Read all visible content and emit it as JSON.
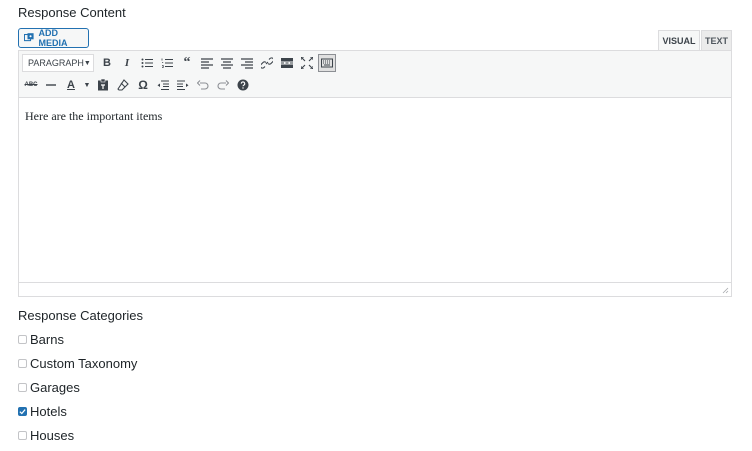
{
  "response_content": {
    "title": "Response Content",
    "add_media_label": "ADD MEDIA",
    "tabs": {
      "visual": "VISUAL",
      "text": "TEXT"
    },
    "format_select": "PARAGRAPH",
    "editor_text": "Here are the important items"
  },
  "response_categories": {
    "title": "Response Categories",
    "items": [
      {
        "label": "Barns",
        "checked": false
      },
      {
        "label": "Custom Taxonomy",
        "checked": false
      },
      {
        "label": "Garages",
        "checked": false
      },
      {
        "label": "Hotels",
        "checked": true
      },
      {
        "label": "Houses",
        "checked": false
      }
    ]
  },
  "colors": {
    "accent": "#2271b1",
    "toolbar_bg": "#f6f7f7",
    "border": "#dcdcde"
  }
}
